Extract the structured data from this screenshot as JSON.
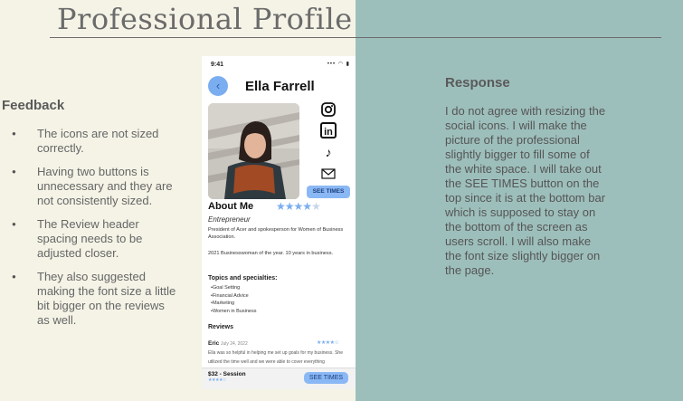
{
  "header": {
    "title": "Professional Profile"
  },
  "feedback": {
    "heading": "Feedback",
    "items": [
      "The icons are not sized correctly.",
      "Having two buttons is unnecessary and they are not consistently sized.",
      "The Review header spacing needs to be adjusted closer.",
      "They also suggested making the font size a little bit bigger on the reviews as well."
    ]
  },
  "response": {
    "heading": "Response",
    "text": "I do not agree with resizing the social icons. I will make the picture of the professional slightly bigger to fill some of the white space. I will take out the SEE TIMES button on the top since it is at the bottom bar which is supposed to stay on the bottom of the screen as users scroll. I will also make the font size slightly bigger on the page."
  },
  "phone": {
    "status_time": "9:41",
    "status_icons": "••• ◠ ▮",
    "back_icon": "chevron-left-icon",
    "back_glyph": "‹",
    "name": "Ella Farrell",
    "see_times_top": "SEE TIMES",
    "about_heading": "About Me",
    "rating_stars": 4,
    "role": "Entrepreneur",
    "bio_line1": "President of Acer and spokesperson for Women of Business Association.",
    "bio_line2": "2021 Businesswoman of the year. 10 years in business.",
    "topics_heading": "Topics and specialties:",
    "topics": [
      "Goal Setting",
      "Financial  Advice",
      "Marketing",
      "Women in Business"
    ],
    "reviews_heading": "Reviews",
    "review": {
      "name": "Eric",
      "date": "July 24, 2022",
      "stars": "★★★★☆",
      "text": "Ella was so helpful in helping me set up goals for my business. She utilized the time well and we were able to cover everything"
    },
    "price": "$32 - Session",
    "price_stars": "★★★★☆",
    "see_times_bottom": "SEE TIMES",
    "social": [
      {
        "icon": "instagram-icon"
      },
      {
        "icon": "linkedin-icon",
        "glyph": "in"
      },
      {
        "icon": "tiktok-icon",
        "glyph": "♪"
      },
      {
        "icon": "mail-icon"
      }
    ]
  },
  "colors": {
    "accent_blue": "#7aaef0",
    "right_panel": "#9dbfbc",
    "left_panel": "#f4f3e6"
  }
}
